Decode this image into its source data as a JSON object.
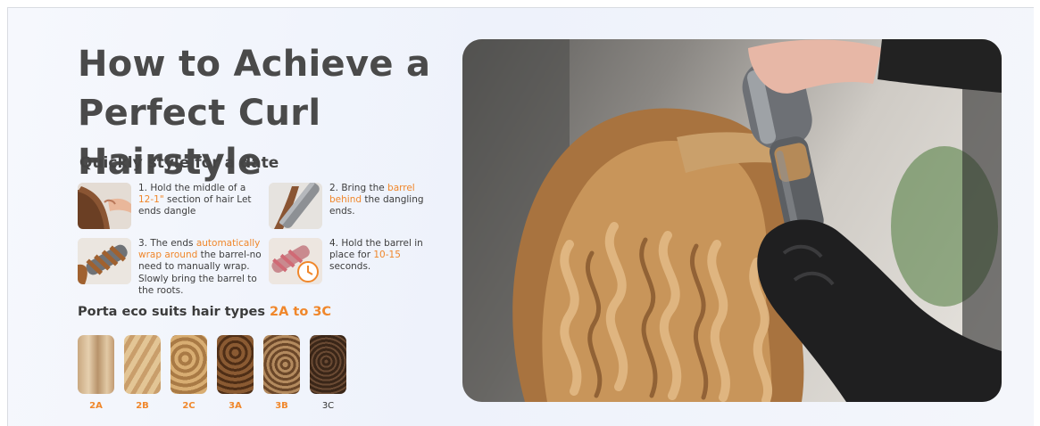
{
  "title_line1": "How to Achieve a",
  "title_line2": "Perfect Curl Hairstyle",
  "subtitle": "Quickly style for a date",
  "steps": [
    {
      "parts": [
        "1. Hold the middle of a ",
        "12-1\"",
        " section of hair Let ends dangle"
      ]
    },
    {
      "parts": [
        "2. Bring the ",
        "barrel behind",
        " the dangling ends."
      ]
    },
    {
      "parts": [
        "3. The ends ",
        "automatically wrap around",
        " the barrel-no need to manually wrap. Slowly bring the barrel to the roots."
      ]
    },
    {
      "parts": [
        "4. Hold the barrel in place for ",
        "10-15",
        " seconds."
      ]
    }
  ],
  "suits_prefix": "Porta eco suits hair types ",
  "suits_range": "2A to 3C",
  "hair_types": [
    "2A",
    "2B",
    "2C",
    "3A",
    "3B",
    "3C"
  ],
  "colors": {
    "accent": "#f0872b",
    "title": "#4a4a4a",
    "background": "#f2f5fc"
  },
  "icons": [
    "hand-hold-hair-icon",
    "barrel-behind-icon",
    "wrap-around-icon",
    "timer-icon"
  ]
}
